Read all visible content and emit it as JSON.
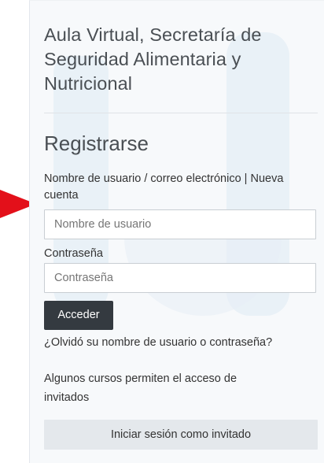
{
  "site": {
    "title": "Aula Virtual, Secretaría de Seguridad Alimentaria y Nutricional"
  },
  "login": {
    "heading": "Registrarse",
    "username_label": "Nombre de usuario / correo electrónico | Nueva cuenta",
    "username_placeholder": "Nombre de usuario",
    "password_label": "Contraseña",
    "password_placeholder": "Contraseña",
    "submit_label": "Acceder",
    "forgot_link": "¿Olvidó su nombre de usuario o contraseña?"
  },
  "guest": {
    "info_text": "Algunos cursos permiten el acceso de invitados",
    "button_label": "Iniciar sesión como invitado"
  },
  "colors": {
    "card_background": "#f7f9fb",
    "primary_button": "#343a40",
    "secondary_button": "#e4e8ec",
    "arrow": "#e3101a"
  },
  "annotation": {
    "icon": "red-arrow-icon"
  }
}
